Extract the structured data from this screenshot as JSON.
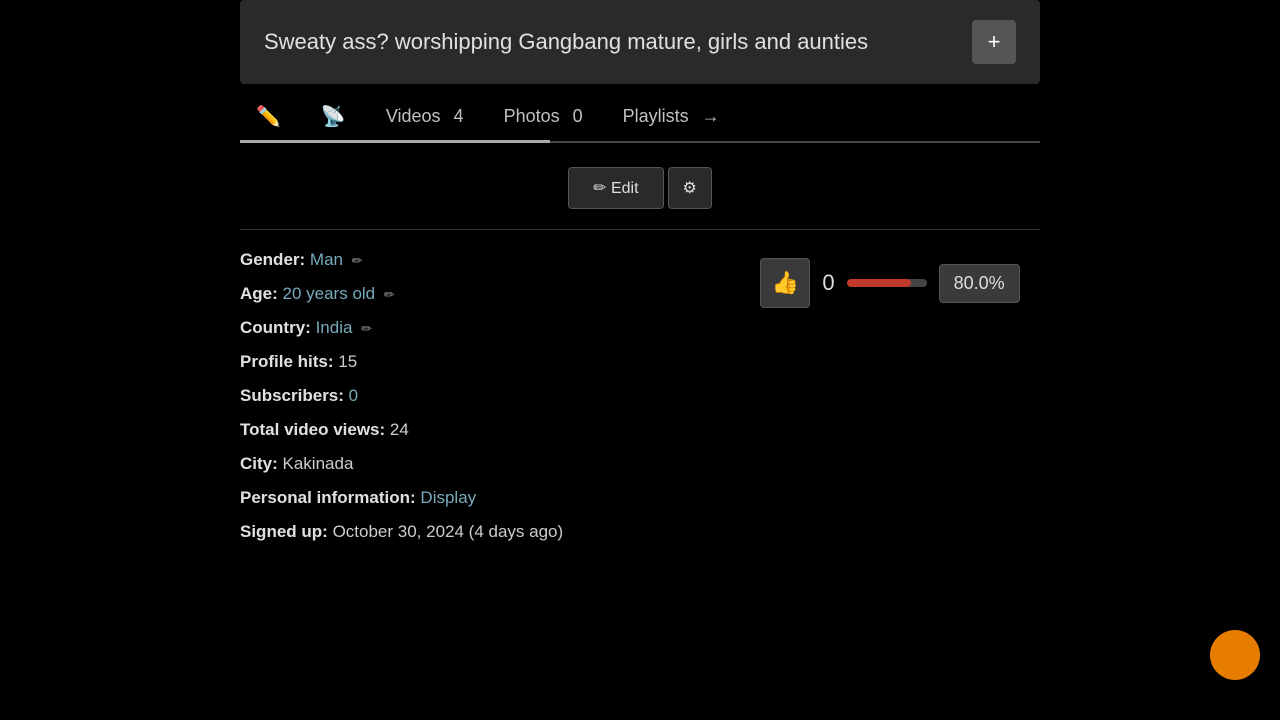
{
  "title": {
    "text": "Sweaty ass? worshipping Gangbang mature, girls and aunties",
    "add_button_label": "+"
  },
  "nav": {
    "tabs": [
      {
        "id": "edit",
        "label": "",
        "icon": "✏️",
        "type": "icon-only",
        "active": true
      },
      {
        "id": "feed",
        "label": "",
        "icon": "📡",
        "type": "icon-only",
        "active": false
      },
      {
        "id": "videos",
        "label": "Videos",
        "count": "4",
        "active": false
      },
      {
        "id": "photos",
        "label": "Photos",
        "count": "0",
        "active": false
      },
      {
        "id": "playlists",
        "label": "Playlists",
        "arrow": "→",
        "active": false
      }
    ]
  },
  "edit_section": {
    "edit_label": "✏ Edit",
    "settings_icon": "⚙"
  },
  "profile": {
    "gender_label": "Gender:",
    "gender_value": "Man",
    "gender_edit_icon": "✏",
    "age_label": "Age:",
    "age_value": "20 years old",
    "age_edit_icon": "✏",
    "country_label": "Country:",
    "country_value": "India",
    "country_edit_icon": "✏",
    "profile_hits_label": "Profile hits:",
    "profile_hits_value": "15",
    "subscribers_label": "Subscribers:",
    "subscribers_value": "0",
    "total_views_label": "Total video views:",
    "total_views_value": "24",
    "city_label": "City:",
    "city_value": "Kakinada",
    "personal_info_label": "Personal information:",
    "personal_info_value": "Display",
    "signed_up_label": "Signed up:",
    "signed_up_value": "October 30, 2024 (4 days ago)"
  },
  "rating": {
    "thumb_icon": "👍",
    "count": "0",
    "bar_percent": 80,
    "percent_label": "80.0%"
  },
  "colors": {
    "accent": "#e67c00",
    "link": "#7aabbf",
    "bg_card": "#2a2a2a",
    "border": "#444"
  }
}
